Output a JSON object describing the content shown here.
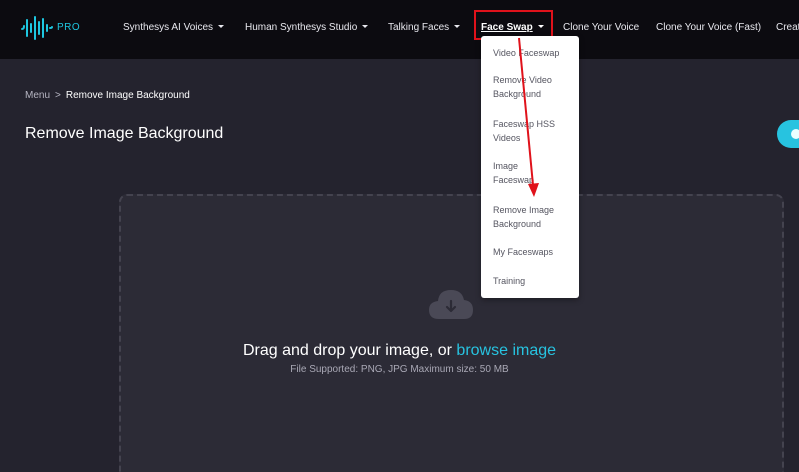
{
  "brand": {
    "badge": "PRO",
    "accent": "#1ec7e0"
  },
  "nav": {
    "items": [
      {
        "label": "Synthesys AI Voices",
        "has_caret": true
      },
      {
        "label": "Human Synthesys Studio",
        "has_caret": true
      },
      {
        "label": "Talking Faces",
        "has_caret": true
      },
      {
        "label": "Face Swap",
        "has_caret": true,
        "active": true
      },
      {
        "label": "Clone Your Voice",
        "has_caret": false
      },
      {
        "label": "Clone Your Voice (Fast)",
        "has_caret": false
      },
      {
        "label": "Creat",
        "has_caret": false
      }
    ]
  },
  "dropdown": {
    "items": [
      {
        "label": "Video Faceswap"
      },
      {
        "label": "Remove Video Background"
      },
      {
        "label": "Faceswap HSS Videos"
      },
      {
        "label": "Image Faceswap"
      },
      {
        "label": "Remove Image Background"
      },
      {
        "label": "My Faceswaps"
      },
      {
        "label": "Training"
      }
    ]
  },
  "breadcrumb": {
    "root": "Menu",
    "separator": ">",
    "current": "Remove Image Background"
  },
  "page": {
    "title": "Remove Image Background"
  },
  "upload": {
    "prompt": "Drag and drop your image, or ",
    "link": "browse image",
    "hint": "File Supported: PNG, JPG Maximum size: 50 MB",
    "icon": "cloud-download-icon"
  },
  "annotation": {
    "color": "#e0121b"
  }
}
